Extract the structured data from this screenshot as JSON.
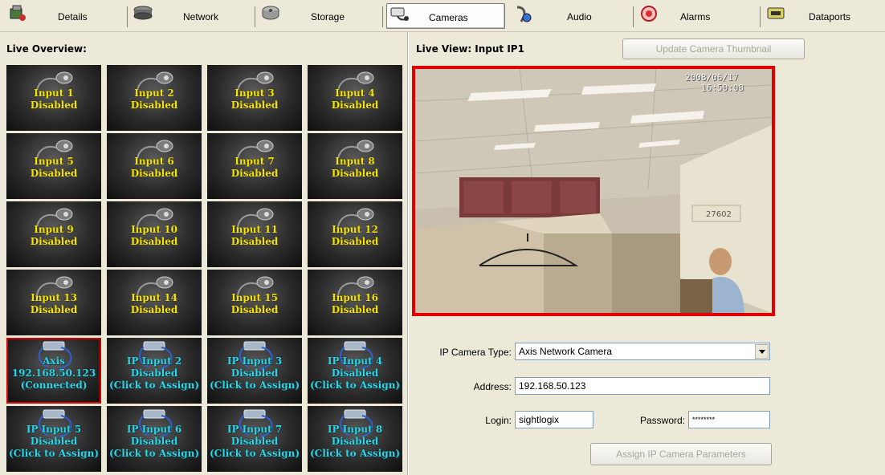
{
  "tabs": [
    {
      "id": "details",
      "label": "Details",
      "icon": "details-icon"
    },
    {
      "id": "network",
      "label": "Network",
      "icon": "network-icon"
    },
    {
      "id": "storage",
      "label": "Storage",
      "icon": "storage-icon"
    },
    {
      "id": "cameras",
      "label": "Cameras",
      "icon": "camera-icon",
      "active": true
    },
    {
      "id": "audio",
      "label": "Audio",
      "icon": "audio-icon"
    },
    {
      "id": "alarms",
      "label": "Alarms",
      "icon": "alarm-icon"
    },
    {
      "id": "dataports",
      "label": "Dataports",
      "icon": "dataport-icon"
    }
  ],
  "left": {
    "title": "Live Overview:",
    "tiles": [
      {
        "type": "analog",
        "lines": [
          "Input 1",
          "Disabled"
        ]
      },
      {
        "type": "analog",
        "lines": [
          "Input 2",
          "Disabled"
        ]
      },
      {
        "type": "analog",
        "lines": [
          "Input 3",
          "Disabled"
        ]
      },
      {
        "type": "analog",
        "lines": [
          "Input 4",
          "Disabled"
        ]
      },
      {
        "type": "analog",
        "lines": [
          "Input 5",
          "Disabled"
        ]
      },
      {
        "type": "analog",
        "lines": [
          "Input 6",
          "Disabled"
        ]
      },
      {
        "type": "analog",
        "lines": [
          "Input 7",
          "Disabled"
        ]
      },
      {
        "type": "analog",
        "lines": [
          "Input 8",
          "Disabled"
        ]
      },
      {
        "type": "analog",
        "lines": [
          "Input 9",
          "Disabled"
        ]
      },
      {
        "type": "analog",
        "lines": [
          "Input 10",
          "Disabled"
        ]
      },
      {
        "type": "analog",
        "lines": [
          "Input 11",
          "Disabled"
        ]
      },
      {
        "type": "analog",
        "lines": [
          "Input 12",
          "Disabled"
        ]
      },
      {
        "type": "analog",
        "lines": [
          "Input 13",
          "Disabled"
        ]
      },
      {
        "type": "analog",
        "lines": [
          "Input 14",
          "Disabled"
        ]
      },
      {
        "type": "analog",
        "lines": [
          "Input 15",
          "Disabled"
        ]
      },
      {
        "type": "analog",
        "lines": [
          "Input 16",
          "Disabled"
        ]
      },
      {
        "type": "ip",
        "lines": [
          "Axis",
          "192.168.50.123",
          "(Connected)"
        ],
        "selected": true
      },
      {
        "type": "ip",
        "lines": [
          "IP Input 2",
          "Disabled",
          "(Click to Assign)"
        ]
      },
      {
        "type": "ip",
        "lines": [
          "IP Input 3",
          "Disabled",
          "(Click to Assign)"
        ]
      },
      {
        "type": "ip",
        "lines": [
          "IP Input 4",
          "Disabled",
          "(Click to Assign)"
        ]
      },
      {
        "type": "ip",
        "lines": [
          "IP Input 5",
          "Disabled",
          "(Click to Assign)"
        ]
      },
      {
        "type": "ip",
        "lines": [
          "IP Input 6",
          "Disabled",
          "(Click to Assign)"
        ]
      },
      {
        "type": "ip",
        "lines": [
          "IP Input 7",
          "Disabled",
          "(Click to Assign)"
        ]
      },
      {
        "type": "ip",
        "lines": [
          "IP Input 8",
          "Disabled",
          "(Click to Assign)"
        ]
      }
    ]
  },
  "right": {
    "title": "Live View: Input IP1",
    "update_button": "Update Camera Thumbnail",
    "video": {
      "date": "2008/06/17",
      "time": "16:50:08",
      "sign": "27602"
    },
    "camera_type_label": "IP Camera Type:",
    "camera_type_value": "Axis Network Camera",
    "address_label": "Address:",
    "address_value": "192.168.50.123",
    "login_label": "Login:",
    "login_value": "sightlogix",
    "password_label": "Password:",
    "password_value": "********",
    "assign_button": "Assign IP Camera Parameters"
  },
  "colors": {
    "selection": "#e00000",
    "analog_text": "#f5e300",
    "ip_text": "#2ed6e8"
  }
}
